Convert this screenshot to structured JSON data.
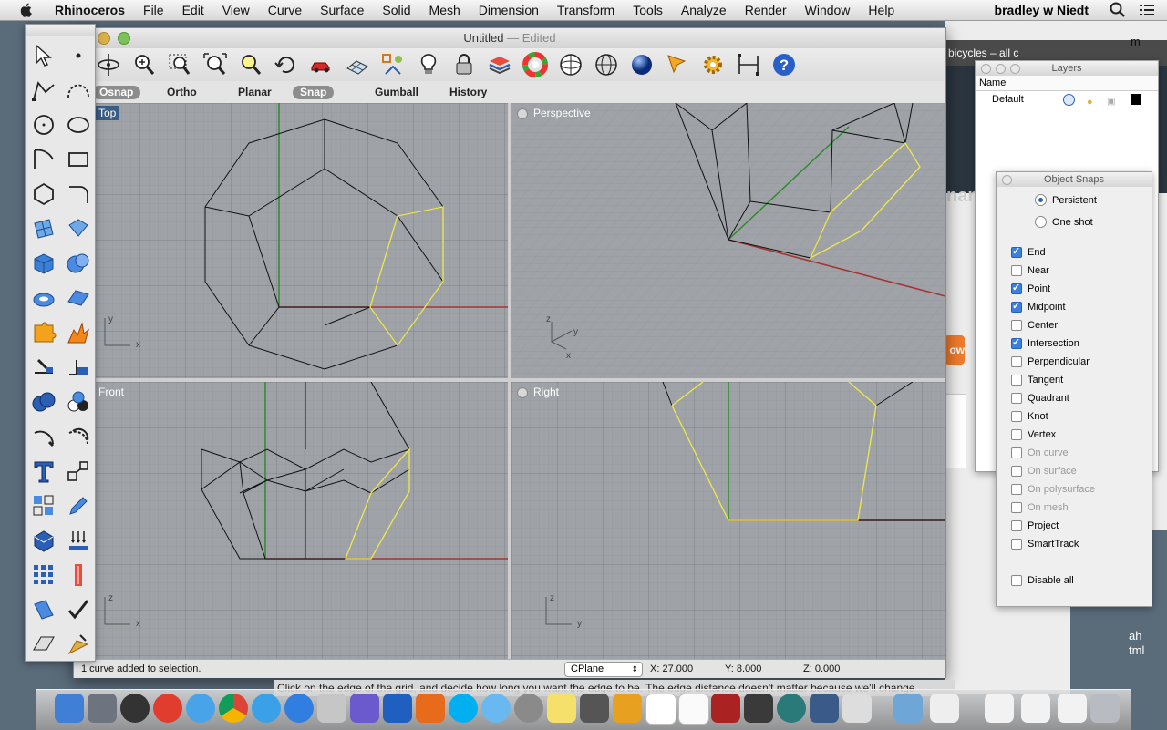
{
  "menubar": {
    "app": "Rhinoceros",
    "items": [
      "File",
      "Edit",
      "View",
      "Curve",
      "Surface",
      "Solid",
      "Mesh",
      "Dimension",
      "Transform",
      "Tools",
      "Analyze",
      "Render",
      "Window",
      "Help"
    ],
    "user": "bradley w Niedt"
  },
  "window": {
    "title": "Untitled",
    "edited": "— Edited"
  },
  "modes": [
    "Osnap",
    "Ortho",
    "Planar",
    "Snap",
    "Gumball",
    "History"
  ],
  "viewports": {
    "top": "Top",
    "perspective": "Perspective",
    "front": "Front",
    "right": "Right"
  },
  "status": {
    "message": "1 curve added to selection.",
    "cplane": "CPlane",
    "x": "X: 27.000",
    "y": "Y: 8.000",
    "z": "Z: 0.000"
  },
  "caption": "Click on the edge of the grid, and decide how long you want the edge to be. The edge distance doesn't matter because we'll change",
  "layers": {
    "title": "Layers",
    "col_name": "Name",
    "rows": [
      {
        "name": "Default"
      }
    ]
  },
  "osnap": {
    "title": "Object Snaps",
    "persistent": "Persistent",
    "oneshot": "One shot",
    "items": [
      {
        "label": "End",
        "checked": true,
        "enabled": true
      },
      {
        "label": "Near",
        "checked": false,
        "enabled": true
      },
      {
        "label": "Point",
        "checked": true,
        "enabled": true
      },
      {
        "label": "Midpoint",
        "checked": true,
        "enabled": true
      },
      {
        "label": "Center",
        "checked": false,
        "enabled": true
      },
      {
        "label": "Intersection",
        "checked": true,
        "enabled": true
      },
      {
        "label": "Perpendicular",
        "checked": false,
        "enabled": true
      },
      {
        "label": "Tangent",
        "checked": false,
        "enabled": true
      },
      {
        "label": "Quadrant",
        "checked": false,
        "enabled": true
      },
      {
        "label": "Knot",
        "checked": false,
        "enabled": true
      },
      {
        "label": "Vertex",
        "checked": false,
        "enabled": true
      },
      {
        "label": "On curve",
        "checked": false,
        "enabled": false
      },
      {
        "label": "On surface",
        "checked": false,
        "enabled": false
      },
      {
        "label": "On polysurface",
        "checked": false,
        "enabled": false
      },
      {
        "label": "On mesh",
        "checked": false,
        "enabled": false
      },
      {
        "label": "Project",
        "checked": false,
        "enabled": true
      },
      {
        "label": "SmartTrack",
        "checked": false,
        "enabled": true
      }
    ],
    "disable_all": "Disable all"
  },
  "background": {
    "tab_text": "bicycles – all c",
    "frag1": "nan",
    "frag2": "ow",
    "frag3": "ah",
    "frag4": "tml",
    "frag5": "m"
  },
  "colors": {
    "selected_curve": "#f0e84a",
    "grid": "#a3a7ac",
    "x_axis": "#a83232",
    "y_axis": "#2f8a2f"
  }
}
